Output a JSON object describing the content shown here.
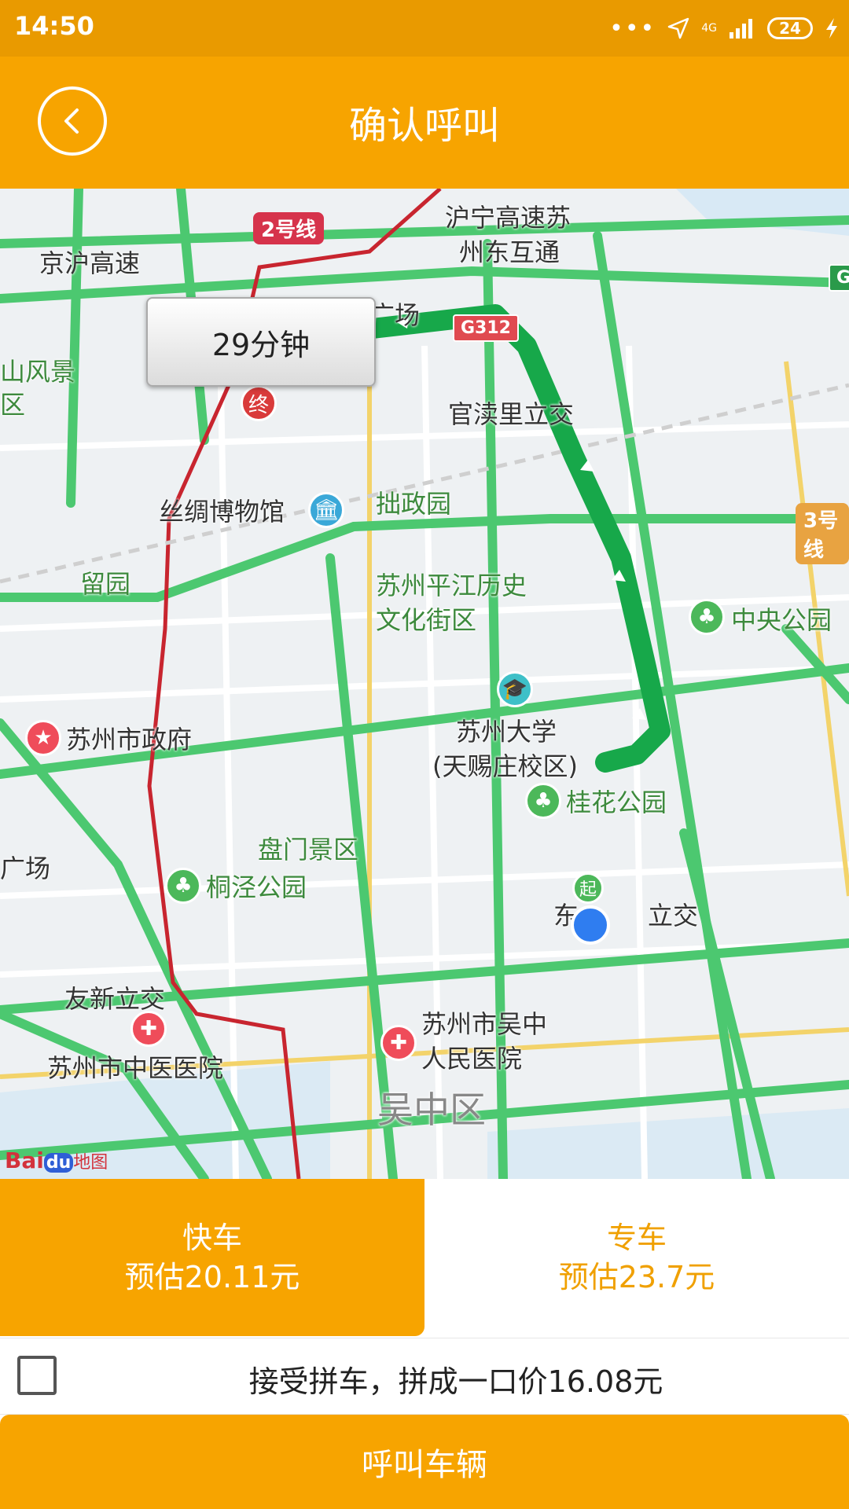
{
  "status_bar": {
    "time": "14:50",
    "network": "4G",
    "battery": "24",
    "icons": [
      "more-dots-icon",
      "location-arrow-icon",
      "signal-icon",
      "battery-icon",
      "charging-icon"
    ]
  },
  "header": {
    "title": "确认呼叫",
    "back_icon": "chevron-left-icon"
  },
  "map": {
    "eta": "29分钟",
    "start_marker": "起",
    "end_marker": "终",
    "logo_text": "Bai",
    "logo_du": "du",
    "logo_map": "地图",
    "labels": {
      "metro_line_2": "2号线",
      "metro_line_3": "3号线",
      "g312": "G312",
      "g_edge": "G",
      "jinghu": "京沪高速",
      "huning": "沪宁高速苏",
      "zhoudong": "州东互通",
      "guangchang_top": "广场",
      "shanfengjing": "山风景",
      "qu_left": "区",
      "guanduli": "官渎里立交",
      "silk_museum": "丝绸博物馆",
      "zhuozheng": "拙政园",
      "liuyuan": "留园",
      "pingjiang_1": "苏州平江历史",
      "pingjiang_2": "文化街区",
      "central_park": "中央公园",
      "city_gov": "苏州市政府",
      "suda_1": "苏州大学",
      "suda_2": "(天赐庄校区)",
      "guihua": "桂花公园",
      "panmen": "盘门景区",
      "guangchang_left": "广场",
      "tongjing": "桐泾公园",
      "dongfang_a": "东",
      "dongfang_b": "立交",
      "youxin": "友新立交",
      "tcm_hosp": "苏州市中医医院",
      "wuzhong_hosp_1": "苏州市吴中",
      "wuzhong_hosp_2": "人民医院",
      "wuzhong": "吴中区"
    }
  },
  "fare_options": [
    {
      "name": "快车",
      "price": "预估20.11元",
      "selected": true
    },
    {
      "name": "专车",
      "price": "预估23.7元",
      "selected": false
    }
  ],
  "carpool": {
    "text": "接受拼车，拼成一口价16.08元",
    "checked": false
  },
  "call_button": "呼叫车辆",
  "colors": {
    "brand": "#f7a400",
    "status_bar": "#e99a00",
    "route": "#17a84a",
    "road_green": "#4cc870",
    "metro_red": "#c8252f"
  }
}
